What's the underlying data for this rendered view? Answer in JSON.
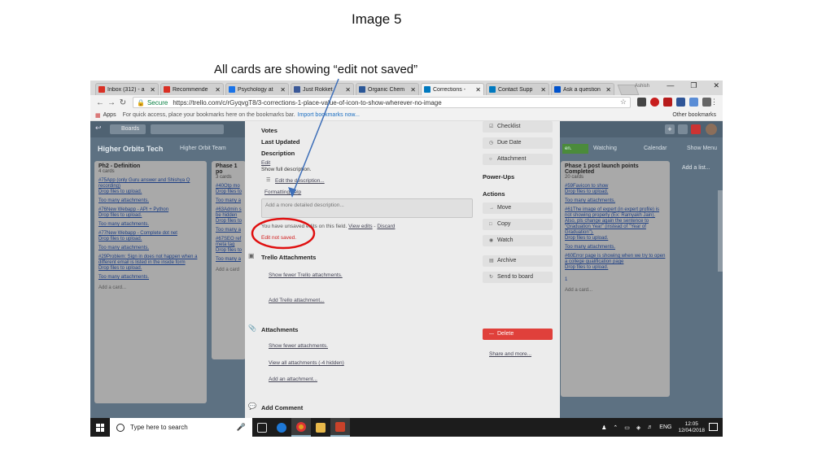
{
  "slide": {
    "title": "Image 5",
    "caption": "All cards are showing “edit not saved”"
  },
  "browser": {
    "tabs": [
      {
        "label": "Inbox (312) - a",
        "icon": "gmail-icon",
        "color": "#d93025"
      },
      {
        "label": "Recommende",
        "icon": "gmail-icon",
        "color": "#d93025"
      },
      {
        "label": "Psychology at",
        "icon": "link-icon",
        "color": "#1a73e8"
      },
      {
        "label": "Just Rokket",
        "icon": "facebook-icon",
        "color": "#3b5998"
      },
      {
        "label": "Organic Chem",
        "icon": "dk-icon",
        "color": "#2b5797"
      },
      {
        "label": "Corrections -",
        "icon": "trello-icon",
        "color": "#0079bf"
      },
      {
        "label": "Contact Supp",
        "icon": "trello-icon",
        "color": "#0079bf"
      },
      {
        "label": "Ask a question",
        "icon": "atlassian-icon",
        "color": "#0052cc"
      }
    ],
    "profile": "Ashish",
    "secure_label": "Secure",
    "url": "https://trello.com/c/rGyqvgT8/3-corrections-1-place-value-of-icon-to-show-wherever-no-image",
    "bookmarks": {
      "apps": "Apps",
      "hint": "For quick access, place your bookmarks here on the bookmarks bar.",
      "import": "Import bookmarks now...",
      "other": "Other bookmarks"
    }
  },
  "board": {
    "boards_label": "Boards",
    "title": "Higher Orbits Tech",
    "team": "Higher Orbit Team",
    "watching": "Watching",
    "calendar": "Calendar",
    "show_menu": "Show Menu",
    "green_badge": "en.",
    "add_list": "Add a list...",
    "lists": [
      {
        "name": "Ph2 - Definition",
        "count": "4 cards",
        "cards": [
          {
            "title": "#75App (only Guru answer and Shishya Q recording)",
            "drop": "Drop files to upload.",
            "too_many": "Too many attachments."
          },
          {
            "title": "#76New Webapp - API + Python",
            "drop": "Drop files to upload.",
            "too_many": "Too many attachments."
          },
          {
            "title": "#77New Webapp - Complete dot net",
            "drop": "Drop files to upload.",
            "too_many": "Too many attachments."
          },
          {
            "title": "#29Problem: Sign in does not happen when a different email is listed in the inside form",
            "drop": "Drop files to upload.",
            "too_many": "Too many attachments."
          }
        ],
        "add_card": "Add a card..."
      },
      {
        "name": "Phase 1 po",
        "count": "3 cards",
        "cards": [
          {
            "title": "#40Otp mo",
            "drop": "Drop files to",
            "too_many": "Too many a"
          },
          {
            "title": "#63Admin s be hidden",
            "drop": "Drop files to",
            "too_many": "Too many a"
          },
          {
            "title": "#67SEO ref meta tag",
            "drop": "Drop files to",
            "too_many": "Too many a"
          }
        ],
        "add_card": "Add a card"
      },
      {
        "name": "Phase 1 post launch points Completed",
        "count": "20 cards",
        "cards": [
          {
            "title": "#59Favicon to show",
            "drop": "Drop files to upload.",
            "too_many": "Too many attachments."
          },
          {
            "title": "#61The image of expert (in expert profile) is not showing properly (Ex: Ramyakh Jain). Also, pls change again the sentence to \"Graduation Year\" (instead of \"Year of Graduation\").",
            "drop": "Drop files to upload.",
            "too_many": "Too many attachments."
          },
          {
            "title": "#60Error page is showing when we try to open a college qualification page",
            "drop": "Drop files to upload.",
            "too_many": ""
          }
        ],
        "badge": "1",
        "add_card": "Add a card..."
      }
    ]
  },
  "modal": {
    "votes": "Votes",
    "last_updated": "Last Updated",
    "description": "Description",
    "edit": "Edit",
    "show_full": "Show full description.",
    "edit_desc": "Edit the description...",
    "formatting_help": "Formatting help",
    "desc_placeholder": "Add a more detailed description...",
    "unsaved_prefix": "You have unsaved edits on this field.",
    "view_edits": "View edits",
    "sep": " - ",
    "discard": "Discard",
    "not_saved": "Edit not saved.",
    "trello_attachments": "Trello Attachments",
    "show_fewer_trello": "Show fewer Trello attachments.",
    "add_trello": "Add Trello attachment...",
    "attachments": "Attachments",
    "show_fewer": "Show fewer attachments.",
    "view_all": "View all attachments (-4 hidden)",
    "add_attachment": "Add an attachment...",
    "add_comment": "Add Comment",
    "sidebar": {
      "checklist": "Checklist",
      "due_date": "Due Date",
      "attachment": "Attachment",
      "power_ups": "Power-Ups",
      "actions": "Actions",
      "move": "Move",
      "copy": "Copy",
      "watch": "Watch",
      "archive": "Archive",
      "send_to_board": "Send to board",
      "delete": "Delete",
      "share": "Share and more..."
    }
  },
  "taskbar": {
    "search": "Type here to search",
    "lang": "ENG",
    "time": "12:05",
    "date": "12/04/2018"
  },
  "colors": {
    "annotation_red": "#e01010",
    "arrow_blue": "#3e6fb8",
    "delete_red": "#e0403b"
  }
}
